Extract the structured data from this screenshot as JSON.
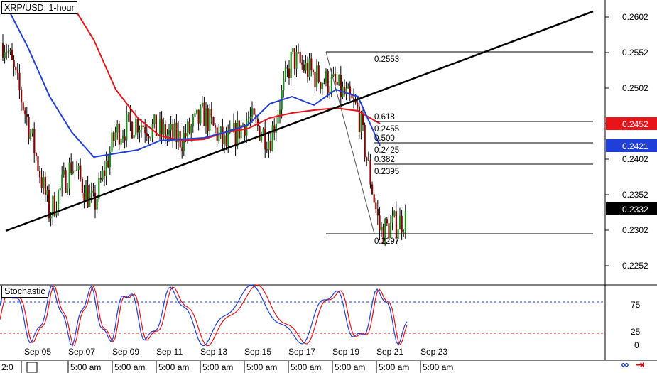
{
  "header": {
    "title": "XRP/USD: 1-hour"
  },
  "stochastic": {
    "label": "Stochastic",
    "levels": [
      "75",
      "25",
      "0"
    ]
  },
  "price_axis": {
    "ticks": [
      "0.2602",
      "0.2552",
      "0.2502",
      "0.2452",
      "0.2402",
      "0.2352",
      "0.2302",
      "0.2252"
    ]
  },
  "badges": [
    {
      "label": "0.2452",
      "value": 0.2452,
      "color": "#e8141a"
    },
    {
      "label": "0.2421",
      "value": 0.2421,
      "color": "#1f3fd8"
    },
    {
      "label": "0.2332",
      "value": 0.2332,
      "color": "#000000"
    }
  ],
  "date_labels": [
    "Sep 05",
    "Sep 07",
    "Sep 09",
    "Sep 11",
    "Sep 13",
    "Sep 15",
    "Sep 17",
    "Sep 19",
    "Sep 21",
    "Sep 23"
  ],
  "time_labels": [
    "2:0",
    "5:00 am",
    "5:00 am",
    "5:00 am",
    "5:00 am",
    "5:00 am",
    "5:00 am",
    "5:00 am",
    "5:00 am",
    "5:00 am"
  ],
  "fib": {
    "high_label": "0.2553",
    "low_label": "0.2297",
    "levels": [
      {
        "ratio": "0.618",
        "price": "0.2455",
        "value": 0.2455
      },
      {
        "ratio": "0.500",
        "price": "0.2425",
        "value": 0.2425
      },
      {
        "ratio": "0.382",
        "price": "0.2395",
        "value": 0.2395
      }
    ]
  },
  "chart_data": {
    "type": "candlestick",
    "title": "XRP/USD: 1-hour",
    "y_range": [
      0.2226,
      0.2626
    ],
    "x_range": [
      "Sep 05",
      "Sep 23"
    ],
    "series": [
      {
        "name": "close",
        "x": [
          "Sep 04",
          "Sep 05",
          "Sep 06",
          "Sep 07",
          "Sep 08",
          "Sep 09",
          "Sep 10",
          "Sep 11",
          "Sep 12",
          "Sep 13",
          "Sep 14",
          "Sep 15",
          "Sep 16",
          "Sep 17",
          "Sep 18",
          "Sep 19",
          "Sep 20",
          "Sep 21",
          "Sep 22",
          "Sep 23"
        ],
        "y": [
          0.2565,
          0.2455,
          0.2325,
          0.2395,
          0.2335,
          0.244,
          0.2455,
          0.244,
          0.243,
          0.2465,
          0.242,
          0.246,
          0.243,
          0.2545,
          0.252,
          0.2505,
          0.247,
          0.23,
          0.2315,
          0.2332
        ]
      },
      {
        "name": "ma_blue",
        "x": [
          "Sep 04",
          "Sep 05",
          "Sep 06",
          "Sep 07",
          "Sep 08",
          "Sep 09",
          "Sep 10",
          "Sep 11",
          "Sep 12",
          "Sep 13",
          "Sep 14",
          "Sep 15",
          "Sep 16",
          "Sep 17",
          "Sep 18",
          "Sep 19",
          "Sep 20",
          "Sep 21"
        ],
        "y": [
          0.262,
          0.256,
          0.249,
          0.244,
          0.2405,
          0.241,
          0.2415,
          0.2428,
          0.243,
          0.2432,
          0.244,
          0.245,
          0.248,
          0.249,
          0.2478,
          0.25,
          0.249,
          0.2421
        ]
      },
      {
        "name": "ma_red",
        "x": [
          "Sep 07",
          "Sep 08",
          "Sep 09",
          "Sep 10",
          "Sep 11",
          "Sep 12",
          "Sep 13",
          "Sep 14",
          "Sep 15",
          "Sep 16",
          "Sep 17",
          "Sep 18",
          "Sep 19",
          "Sep 20",
          "Sep 21"
        ],
        "y": [
          0.262,
          0.257,
          0.25,
          0.246,
          0.2435,
          0.2428,
          0.243,
          0.244,
          0.2445,
          0.246,
          0.2467,
          0.2471,
          0.2474,
          0.247,
          0.2452
        ]
      }
    ],
    "trendline": {
      "from": {
        "x": "Sep 04",
        "y": 0.2301
      },
      "to": {
        "x": "Sep 23",
        "y": 0.2521
      }
    },
    "stochastic": {
      "range": [
        0,
        100
      ],
      "overbought": 80,
      "oversold": 20
    },
    "grid": false,
    "legend": "none"
  }
}
